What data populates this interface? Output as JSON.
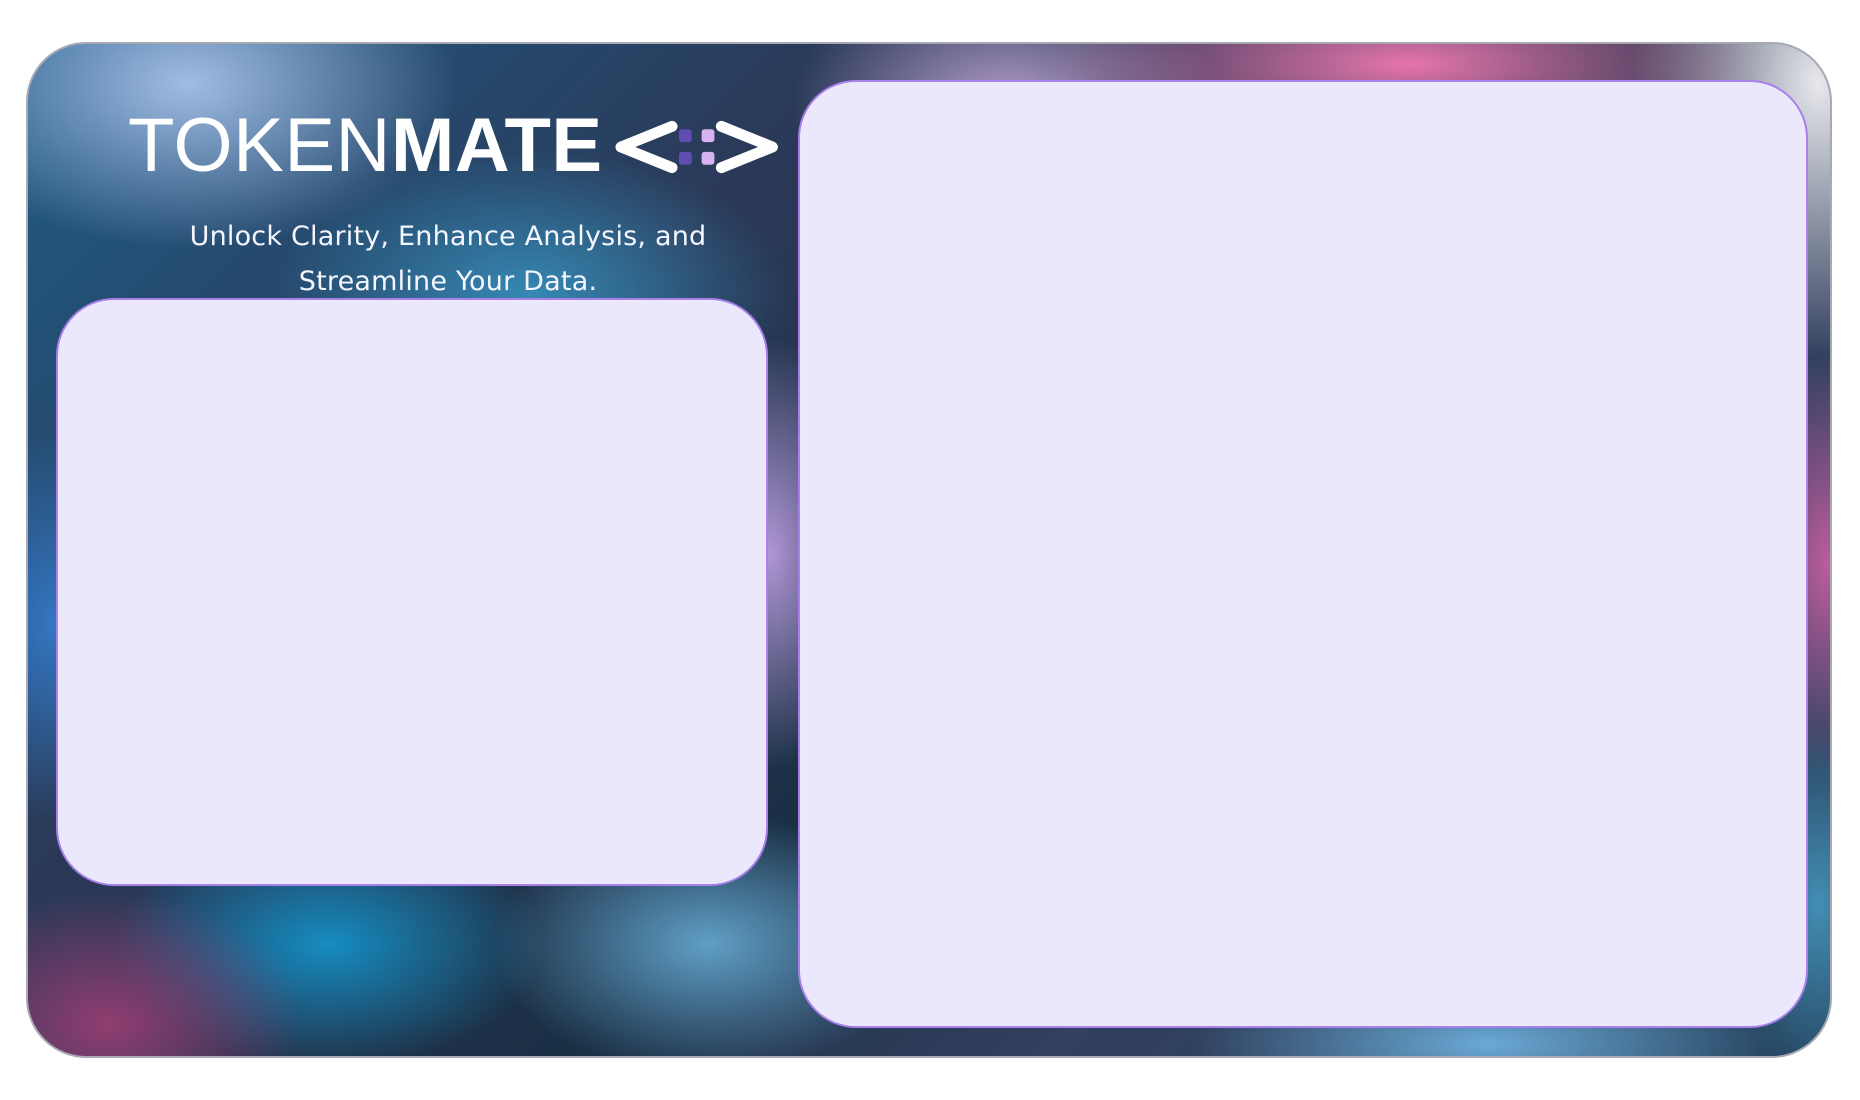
{
  "brand": {
    "name_light": "TOKEN",
    "name_bold": "MATE",
    "logo_icon": "code-brackets-dots-icon",
    "colors": {
      "dot_primary": "#5f4db3",
      "dot_secondary": "#d9b2f1",
      "panel_fill": "#ebe8fe",
      "panel_border": "#a880ea"
    }
  },
  "tagline": {
    "line1": "Unlock Clarity, Enhance Analysis, and",
    "line2": "Streamline Your Data."
  }
}
